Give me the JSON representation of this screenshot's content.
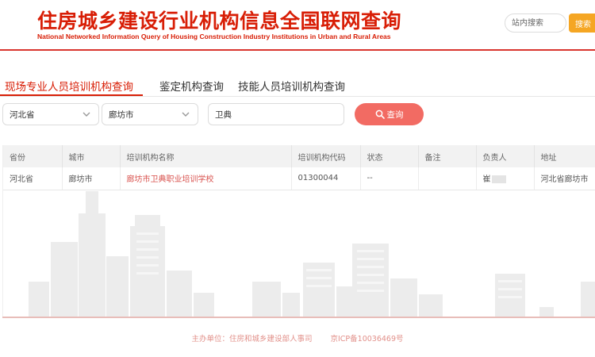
{
  "header": {
    "title": "住房城乡建设行业机构信息全国联网查询",
    "subtitle": "National Networked Information Query of Housing Construction Industry Institutions in Urban and Rural Areas",
    "site_search_placeholder": "站内搜索",
    "site_search_button": "搜索"
  },
  "tabs": [
    {
      "label": "现场专业人员培训机构查询",
      "active": true
    },
    {
      "label": "鉴定机构查询",
      "active": false
    },
    {
      "label": "技能人员培训机构查询",
      "active": false
    }
  ],
  "filters": {
    "province": "河北省",
    "city": "廊坊市",
    "keyword": "卫典",
    "query_button": "查询"
  },
  "table": {
    "columns": [
      "省份",
      "城市",
      "培训机构名称",
      "培训机构代码",
      "状态",
      "备注",
      "负责人",
      "地址"
    ],
    "rows": [
      {
        "province": "河北省",
        "city": "廊坊市",
        "name": "廊坊市卫典职业培训学校",
        "code": "01300044",
        "status": "--",
        "note": "",
        "manager": "崔",
        "address": "河北省廊坊市"
      }
    ]
  },
  "footer": {
    "sponsor": "主办单位：住房和城乡建设部人事司",
    "icp": "京ICP备10036469号"
  },
  "colors": {
    "brand_red": "#d81e06",
    "query_button": "#f26b63",
    "search_button": "#f5a623",
    "footer_text": "#e2908a"
  }
}
